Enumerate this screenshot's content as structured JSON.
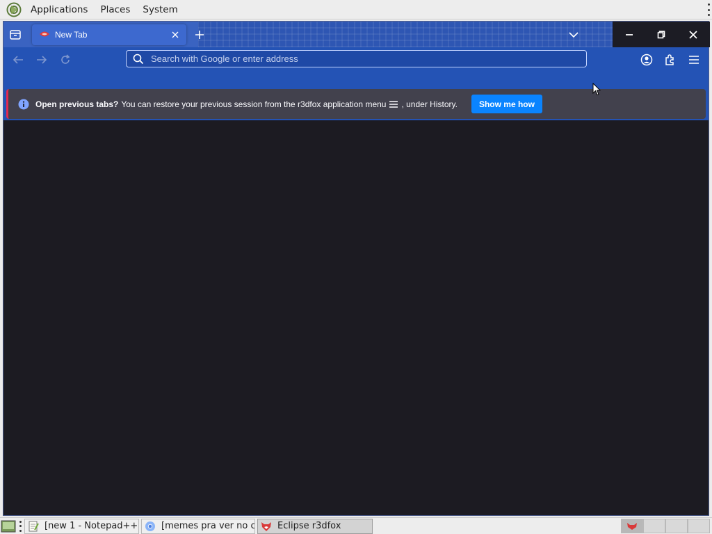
{
  "top_panel": {
    "menus": [
      "Applications",
      "Places",
      "System"
    ]
  },
  "browser": {
    "tab": {
      "title": "New Tab"
    },
    "url_bar": {
      "placeholder": "Search with Google or enter address"
    },
    "notification": {
      "bold_text": "Open previous tabs?",
      "text_before_icon": "You can restore your previous session from the r3dfox application menu",
      "text_after_icon": ", under History.",
      "button_label": "Show me how"
    },
    "colors": {
      "toolbar": "#2453b5",
      "tab_strip": "#2e56b3",
      "content": "#1c1b22",
      "notification_bg": "#42414d",
      "button_accent": "#0a84ff"
    }
  },
  "taskbar": {
    "tasks": [
      {
        "label": "[new 1 - Notepad++...",
        "icon": "notepad-icon"
      },
      {
        "label": "[memes pra ver no c...",
        "icon": "chromium-icon"
      },
      {
        "label": "Eclipse r3dfox",
        "icon": "r3dfox-icon"
      }
    ]
  }
}
